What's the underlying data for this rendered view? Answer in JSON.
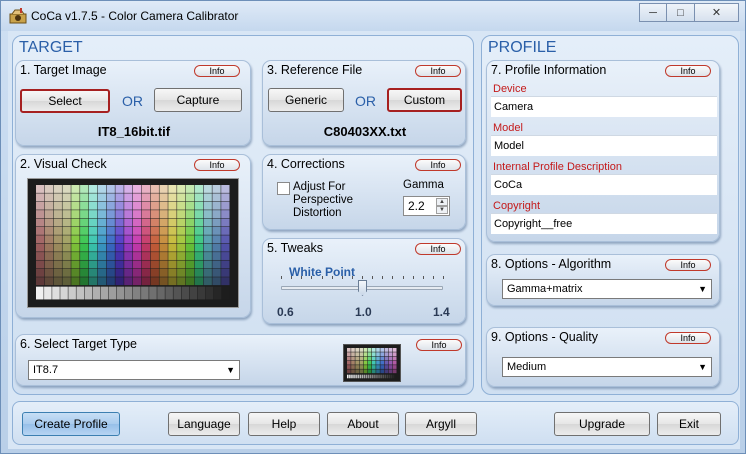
{
  "window": {
    "title": "CoCa v1.7.5 - Color Camera Calibrator",
    "controls": [
      "minimize-icon",
      "maximize-icon",
      "close-icon"
    ]
  },
  "target": {
    "title": "TARGET",
    "target_image": {
      "title": "1. Target Image",
      "info": "Info",
      "select_label": "Select",
      "or": "OR",
      "capture_label": "Capture",
      "filename": "IT8_16bit.tif"
    },
    "reference_file": {
      "title": "3. Reference File",
      "info": "Info",
      "generic_label": "Generic",
      "or": "OR",
      "custom_label": "Custom",
      "filename": "C80403XX.txt"
    },
    "visual_check": {
      "title": "2. Visual Check",
      "info": "Info"
    },
    "corrections": {
      "title": "4. Corrections",
      "info": "Info",
      "adjust_label": "Adjust For Perspective Distortion",
      "adjust_checked": false,
      "gamma_label": "Gamma",
      "gamma_value": "2.2"
    },
    "tweaks": {
      "title": "5. Tweaks",
      "info": "Info",
      "white_point_label": "White Point",
      "min_label": "0.6",
      "mid_label": "1.0",
      "max_label": "1.4",
      "white_point_value": 1.0,
      "white_point_min": 0.6,
      "white_point_max": 1.4
    },
    "target_type": {
      "title": "6. Select Target Type",
      "info": "Info",
      "selected": "IT8.7"
    }
  },
  "profile": {
    "title": "PROFILE",
    "information": {
      "title": "7. Profile Information",
      "info": "Info",
      "device_label": "Device",
      "device_value": "Camera",
      "model_label": "Model",
      "model_value": "Model",
      "description_label": "Internal Profile Description",
      "description_value": "CoCa",
      "copyright_label": "Copyright",
      "copyright_value": "Copyright__free"
    },
    "algorithm": {
      "title": "8. Options - Algorithm",
      "info": "Info",
      "selected": "Gamma+matrix"
    },
    "quality": {
      "title": "9. Options - Quality",
      "info": "Info",
      "selected": "Medium"
    }
  },
  "footer": {
    "create_profile": "Create Profile",
    "language": "Language",
    "help": "Help",
    "about": "About",
    "argyll": "Argyll",
    "upgrade": "Upgrade",
    "exit": "Exit"
  },
  "colors": {
    "group_title": "#2a5fa8",
    "field_label": "#c41a1a",
    "info_border": "#c0392b",
    "selected_border": "#a62020"
  }
}
